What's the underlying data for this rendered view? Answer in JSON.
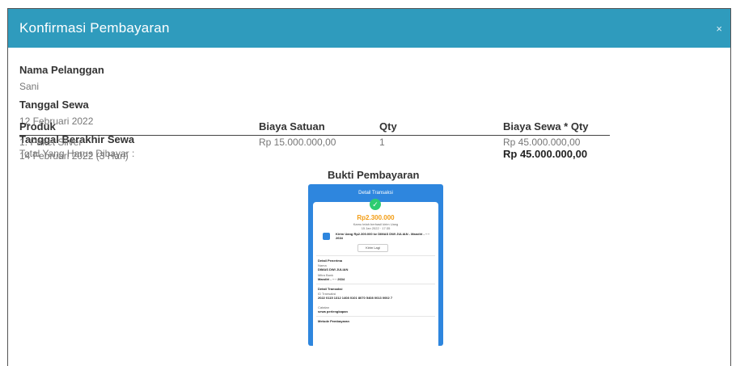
{
  "modal": {
    "title": "Konfirmasi Pembayaran",
    "close_icon": "×"
  },
  "customer": {
    "label": "Nama Pelanggan",
    "value": "Sani"
  },
  "rent_date": {
    "label": "Tanggal Sewa",
    "value": "12 Februari 2022"
  },
  "end_date": {
    "label": "Tanggal Berakhir Sewa",
    "value": "14 Februari 2022 (3 Hari)"
  },
  "table": {
    "headers": [
      "Produk",
      "Biaya Satuan",
      "Qty",
      "Biaya Sewa * Qty"
    ],
    "rows": [
      [
        "1. Paket Silver",
        "Rp 15.000.000,00",
        "1",
        "Rp 45.000.000,00"
      ]
    ],
    "total_label": "Total Yang Harus Dibayar :",
    "total_value": "Rp 45.000.000,00"
  },
  "proof": {
    "title": "Bukti Pembayaran",
    "receipt": {
      "header": "Detail Transaksi",
      "amount": "Rp2.300.000",
      "sub1": "Kamu telah berhasil kirim Uang",
      "sub2": "15 Jan 2022 · 17:35",
      "transfer": "Kirim Uang Rp2.300.000 ke DIMAS DWI JULIAN - Mandiri - ···· 2634",
      "button": "Kirim Lagi",
      "sec1_title": "Detail Penerima",
      "sec1_l1": "Nama",
      "sec1_v1": "DIMAS DWI JULIAN",
      "sec1_l2": "Mitra Bank",
      "sec1_v2": "Mandiri - ···· 2634",
      "sec2_title": "Detail Transaksi",
      "sec2_l1": "ID Transaksi",
      "sec2_v1": "2022 0115 1312 1408 0101 8070 5408 0013 0002 7",
      "sec2_l2": "Catatan",
      "sec2_v2": "sewa perlengkapan",
      "sec3_title": "Metode Pembayaran"
    }
  }
}
